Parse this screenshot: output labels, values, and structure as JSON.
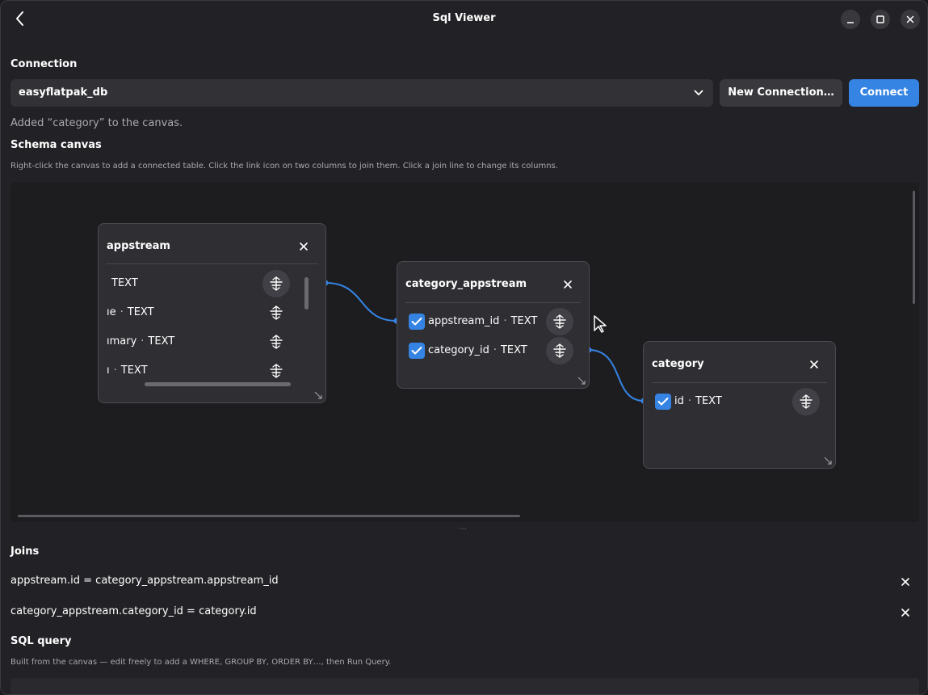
{
  "window": {
    "title": "Sql Viewer"
  },
  "connection": {
    "label": "Connection",
    "selected": "easyflatpak_db",
    "new_button": "New Connection…",
    "connect_button": "Connect",
    "status": "Added “category” to the canvas."
  },
  "schema": {
    "label": "Schema canvas",
    "hint": "Right-click the canvas to add a connected table. Click the link icon on two columns to join them. Click a join line to change its columns.",
    "tables": [
      {
        "name": "appstream",
        "columns": [
          {
            "name": "",
            "type": "TEXT"
          },
          {
            "name": "ıe",
            "type": "TEXT"
          },
          {
            "name": "ımary",
            "type": "TEXT"
          },
          {
            "name": "ı",
            "type": "TEXT"
          }
        ]
      },
      {
        "name": "category_appstream",
        "columns": [
          {
            "name": "appstream_id",
            "type": "TEXT"
          },
          {
            "name": "category_id",
            "type": "TEXT"
          }
        ]
      },
      {
        "name": "category",
        "columns": [
          {
            "name": "id",
            "type": "TEXT"
          }
        ]
      }
    ],
    "dot": "·"
  },
  "joins": {
    "label": "Joins",
    "items": [
      "appstream.id  =  category_appstream.appstream_id",
      "category_appstream.category_id  =  category.id"
    ]
  },
  "sql": {
    "label": "SQL query",
    "hint": "Built from the canvas — edit freely to add a WHERE, GROUP BY, ORDER BY…, then Run Query."
  },
  "colors": {
    "accent": "#3584e4",
    "link_line": "#3584e4",
    "surface": "#222226",
    "canvas": "#1d1d20",
    "card": "#2e2e33"
  },
  "icons": {
    "back": "chevron-left-icon",
    "minimize": "minimize-icon",
    "maximize": "maximize-icon",
    "close": "close-icon",
    "dropdown": "chevron-down-icon",
    "link": "link-icon",
    "check": "check-icon",
    "resize": "resize-grip-icon"
  }
}
